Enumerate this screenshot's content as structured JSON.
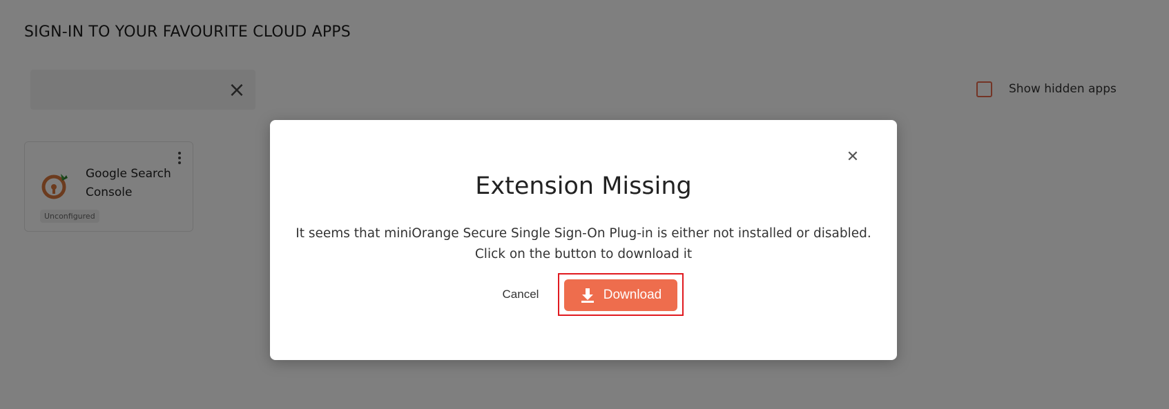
{
  "page": {
    "title": "SIGN-IN TO YOUR FAVOURITE CLOUD APPS",
    "search": {
      "value": "",
      "clear_icon": "close-icon"
    },
    "show_hidden_label": "Show hidden apps",
    "show_hidden_checked": false
  },
  "apps": [
    {
      "name": "Google Search Console",
      "status": "Unconfigured",
      "logo_icon": "google-search-console-logo",
      "menu_icon": "more-vertical-icon"
    }
  ],
  "modal": {
    "title": "Extension Missing",
    "message_line1": "It seems that miniOrange Secure Single Sign-On Plug-in is either not installed or disabled.",
    "message_line2": "Click on the button to download it",
    "cancel_label": "Cancel",
    "download_label": "Download",
    "close_icon": "close-icon",
    "download_icon": "download-icon"
  },
  "colors": {
    "accent": "#ee6d4d",
    "highlight_border": "#e0191f",
    "overlay": "rgba(0,0,0,0.5)"
  }
}
